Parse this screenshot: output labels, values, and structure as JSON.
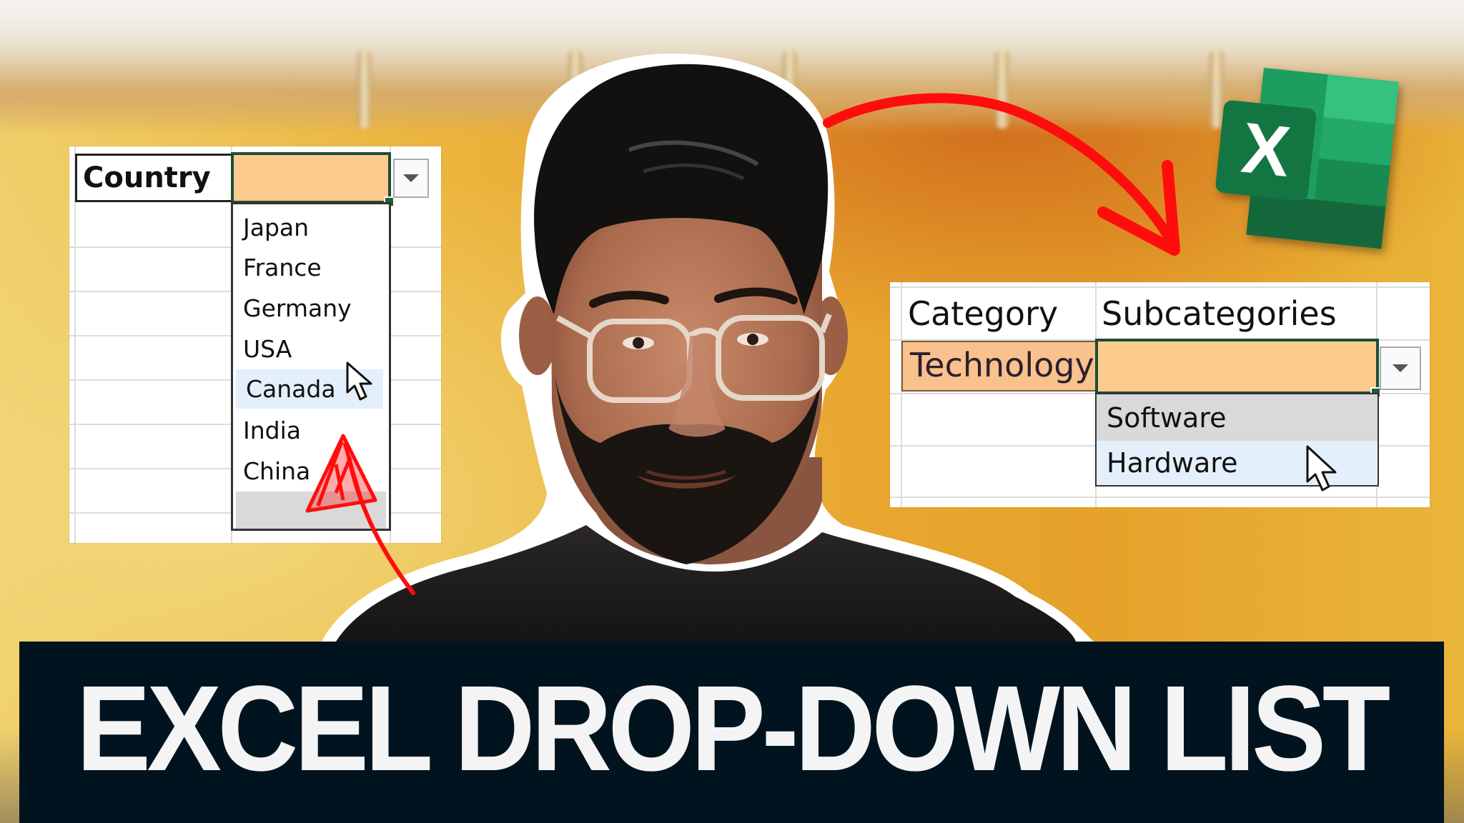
{
  "thumbnail": {
    "banner_title": "EXCEL DROP-DOWN LIST",
    "accent_color": "#ff0d0d",
    "banner_bg": "#01131f",
    "highlight_fill": "#fccb8e"
  },
  "country_panel": {
    "header_label": "Country",
    "selected_value": "",
    "dropdown_icon": "chevron-down-icon",
    "options": [
      "Japan",
      "France",
      "Germany",
      "USA",
      "Canada",
      "India",
      "China"
    ],
    "hovered_option": "Canada"
  },
  "category_panel": {
    "column_headers": [
      "Category",
      "Subcategories"
    ],
    "category_value": "Technology",
    "selected_value": "",
    "dropdown_icon": "chevron-down-icon",
    "options": [
      "Software",
      "Hardware"
    ],
    "hovered_option": "Hardware",
    "highlighted_option": "Software"
  },
  "logo": {
    "letter": "X",
    "name": "excel-logo"
  }
}
